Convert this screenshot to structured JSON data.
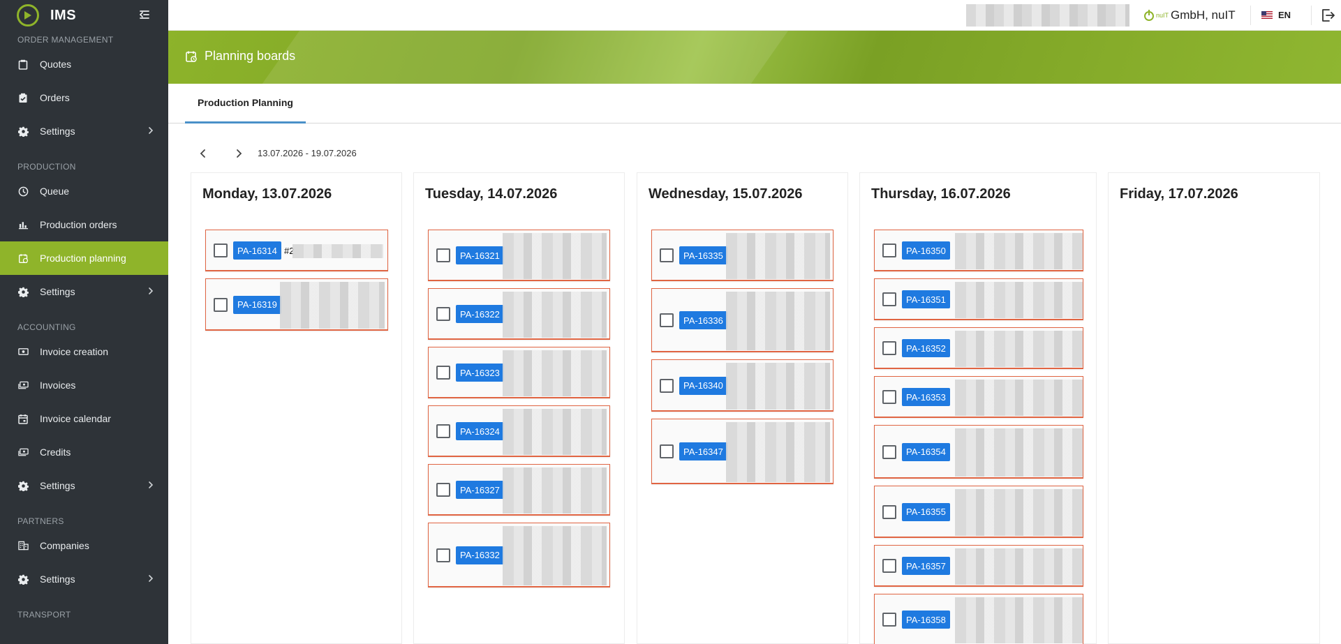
{
  "app": {
    "title": "IMS",
    "company": "GmbH, nuIT",
    "company_logo_text": "nuIT",
    "language": "EN",
    "accent_color": "#8fb42a",
    "sidebar_bg": "#2e3338",
    "badge_color": "#1f7ae0",
    "card_border_color": "#e06442"
  },
  "sidebar": {
    "sections": [
      {
        "label": "ORDER MANAGEMENT",
        "items": [
          {
            "label": "Quotes",
            "icon": "clipboard-icon"
          },
          {
            "label": "Orders",
            "icon": "clipboard-check-icon"
          },
          {
            "label": "Settings",
            "icon": "gear-icon",
            "submenu": true
          }
        ]
      },
      {
        "label": "PRODUCTION",
        "items": [
          {
            "label": "Queue",
            "icon": "clock-icon"
          },
          {
            "label": "Production orders",
            "icon": "bar-chart-icon"
          },
          {
            "label": "Production planning",
            "icon": "calendar-clock-icon",
            "active": true
          },
          {
            "label": "Settings",
            "icon": "gear-icon",
            "submenu": true
          }
        ]
      },
      {
        "label": "ACCOUNTING",
        "items": [
          {
            "label": "Invoice creation",
            "icon": "money-add-icon"
          },
          {
            "label": "Invoices",
            "icon": "money-stack-icon"
          },
          {
            "label": "Invoice calendar",
            "icon": "calendar-icon"
          },
          {
            "label": "Credits",
            "icon": "money-back-icon"
          },
          {
            "label": "Settings",
            "icon": "gear-icon",
            "submenu": true
          }
        ]
      },
      {
        "label": "PARTNERS",
        "items": [
          {
            "label": "Companies",
            "icon": "building-icon"
          },
          {
            "label": "Settings",
            "icon": "gear-icon",
            "submenu": true
          }
        ]
      },
      {
        "label": "TRANSPORT",
        "items": []
      }
    ]
  },
  "banner": {
    "title": "Planning boards"
  },
  "tabs": [
    {
      "label": "Production Planning",
      "active": true
    }
  ],
  "week": {
    "range": "13.07.2026 - 19.07.2026"
  },
  "days": [
    {
      "title": "Monday, 13.07.2026",
      "cards": [
        {
          "id": "PA-16314",
          "ref": "#2"
        },
        {
          "id": "PA-16319"
        }
      ]
    },
    {
      "title": "Tuesday, 14.07.2026",
      "cards": [
        {
          "id": "PA-16321"
        },
        {
          "id": "PA-16322"
        },
        {
          "id": "PA-16323"
        },
        {
          "id": "PA-16324"
        },
        {
          "id": "PA-16327"
        },
        {
          "id": "PA-16332"
        }
      ]
    },
    {
      "title": "Wednesday, 15.07.2026",
      "cards": [
        {
          "id": "PA-16335"
        },
        {
          "id": "PA-16336"
        },
        {
          "id": "PA-16340"
        },
        {
          "id": "PA-16347"
        }
      ]
    },
    {
      "title": "Thursday, 16.07.2026",
      "cards": [
        {
          "id": "PA-16350"
        },
        {
          "id": "PA-16351"
        },
        {
          "id": "PA-16352"
        },
        {
          "id": "PA-16353"
        },
        {
          "id": "PA-16354"
        },
        {
          "id": "PA-16355"
        },
        {
          "id": "PA-16357"
        },
        {
          "id": "PA-16358"
        }
      ]
    },
    {
      "title": "Friday, 17.07.2026",
      "cards": []
    }
  ]
}
